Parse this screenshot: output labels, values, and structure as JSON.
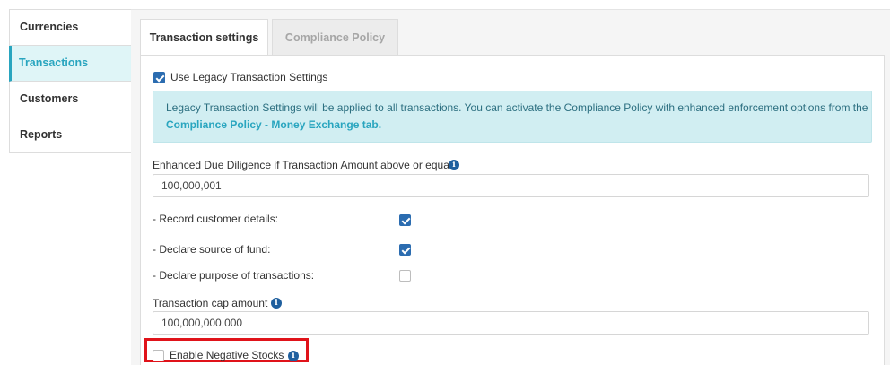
{
  "sidebar": {
    "items": [
      {
        "label": "Currencies"
      },
      {
        "label": "Transactions"
      },
      {
        "label": "Customers"
      },
      {
        "label": "Reports"
      }
    ]
  },
  "tabs": [
    {
      "label": "Transaction settings"
    },
    {
      "label": "Compliance Policy"
    }
  ],
  "legacy": {
    "checked": true,
    "label": "Use Legacy Transaction Settings"
  },
  "alert": {
    "line1": "Legacy Transaction Settings will be applied to all transactions. You can activate the Compliance Policy with enhanced enforcement options from the",
    "link": "Compliance Policy - Money Exchange tab."
  },
  "edd": {
    "label": "Enhanced Due Diligence if Transaction Amount above or equal",
    "value": "100,000,001"
  },
  "options": [
    {
      "label": "- Record customer details:",
      "checked": true
    },
    {
      "label": "- Declare source of fund:",
      "checked": true
    },
    {
      "label": "- Declare purpose of transactions:",
      "checked": false
    }
  ],
  "cap": {
    "label": "Transaction cap amount",
    "value": "100,000,000,000"
  },
  "negative_stocks": {
    "label": "Enable Negative Stocks",
    "checked": false
  },
  "icons": {
    "info": "info-icon"
  },
  "colors": {
    "accent": "#29a5bf",
    "checkbox": "#2b6cb0",
    "alert_bg": "#d1eef2",
    "highlight": "#e0131a"
  }
}
